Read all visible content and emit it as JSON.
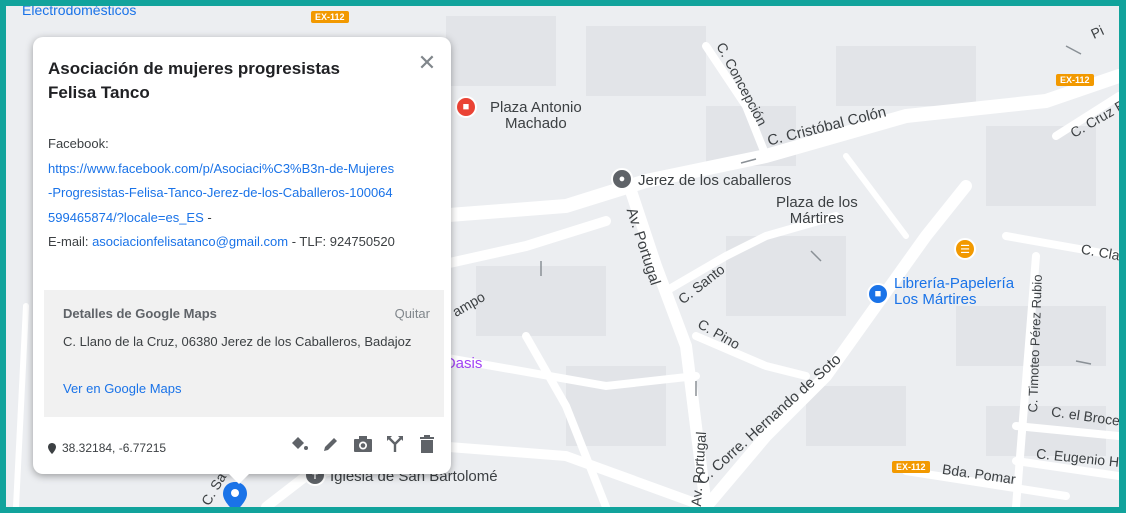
{
  "card": {
    "title": "Asociación de mujeres progresistas Felisa Tanco",
    "close_icon": "close-icon",
    "description": {
      "facebook_label": "Facebook:",
      "facebook_url": "https://www.facebook.com/p/Asociaci%C3%B3n-de-Mujeres-Progresistas-Felisa-Tanco-Jerez-de-los-Caballeros-100064599465874/?locale=es_ES",
      "separator1": " -",
      "email_label": "E-mail: ",
      "email": "asociacionfelisatanco@gmail.com",
      "tel_label": " - TLF: 924750520"
    },
    "google_maps": {
      "title": "Detalles de Google Maps",
      "remove": "Quitar",
      "address": "C. Llano de la Cruz, 06380 Jerez de los Caballeros, Badajoz",
      "link": "Ver en Google Maps"
    },
    "coordinates": "38.32184, -6.77215",
    "tools": [
      "style-icon",
      "edit-icon",
      "camera-icon",
      "directions-icon",
      "delete-icon"
    ]
  },
  "map": {
    "pois": {
      "plaza_antonio": "Plaza Antonio\nMachado",
      "jerez": "Jerez de los caballeros",
      "plaza_martires": "Plaza de los\nMártires",
      "libreria": "Librería-Papelería\nLos Mártires",
      "oasis": "Oasis",
      "iglesia": "Iglesia de San Bartolomé",
      "electro": "Electrodomésticos"
    },
    "streets": {
      "concepcion": "C. Concepción",
      "colon": "C. Cristóbal Colón",
      "portugal1": "Av. Portugal",
      "portugal2": "Av. Portugal",
      "santo": "C. Santo",
      "pino": "C. Pino",
      "hernando": "C. Corre. Hernando de Soto",
      "timoteo": "C. Timoteo Pérez Rubio",
      "broce": "C. el Broce",
      "eugenio": "C. Eugenio He",
      "pomar": "Bda. Pomar",
      "clar": "C. Cla",
      "cruz_blan": "C. Cruz Blan",
      "campo": "ampo",
      "sa": "C. Sa",
      "pi": "Pi"
    },
    "shields": {
      "ex112_a": "EX-112",
      "ex112_b": "EX-112",
      "ex112_c": "EX-112"
    }
  }
}
